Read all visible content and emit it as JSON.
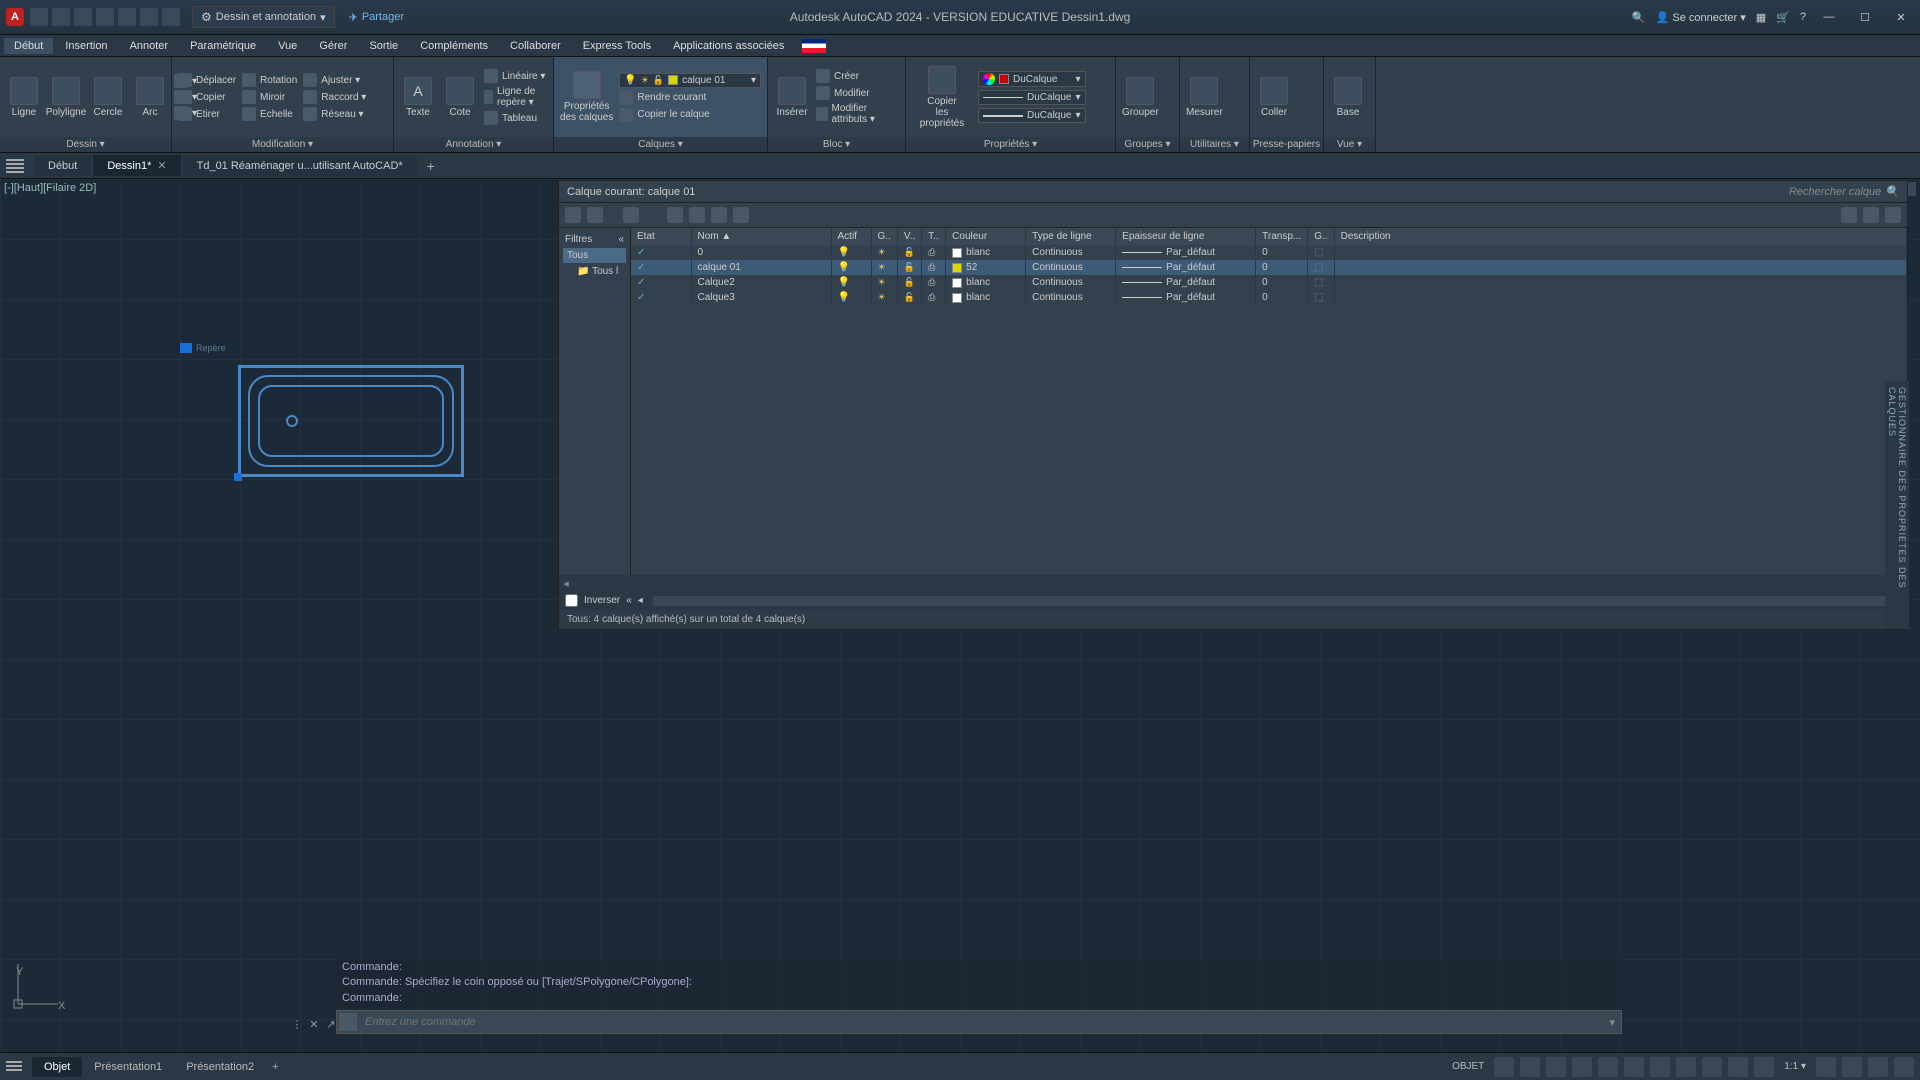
{
  "titlebar": {
    "logo": "A",
    "workspace": "Dessin et annotation",
    "share": "Partager",
    "center": "Autodesk AutoCAD 2024 - VERSION EDUCATIVE   Dessin1.dwg",
    "signin": "Se connecter"
  },
  "menus": [
    "Début",
    "Insertion",
    "Annoter",
    "Paramétrique",
    "Vue",
    "Gérer",
    "Sortie",
    "Compléments",
    "Collaborer",
    "Express Tools",
    "Applications associées"
  ],
  "menu_active": 0,
  "ribbon": {
    "dessin": {
      "title": "Dessin ▾",
      "items": [
        "Ligne",
        "Polyligne",
        "Cercle",
        "Arc"
      ]
    },
    "modif": {
      "title": "Modification ▾",
      "rows": [
        {
          "icon": "move",
          "label": "Déplacer"
        },
        {
          "icon": "rotate",
          "label": "Rotation"
        },
        {
          "icon": "trim",
          "label": "Ajuster ▾"
        },
        {
          "icon": "copy",
          "label": "Copier"
        },
        {
          "icon": "mirror",
          "label": "Miroir"
        },
        {
          "icon": "fillet",
          "label": "Raccord ▾"
        },
        {
          "icon": "stretch",
          "label": "Etirer"
        },
        {
          "icon": "scale",
          "label": "Echelle"
        },
        {
          "icon": "array",
          "label": "Réseau ▾"
        }
      ]
    },
    "annot": {
      "title": "Annotation ▾",
      "big": [
        "Texte",
        "Cote"
      ],
      "rows": [
        "Linéaire ▾",
        "Ligne de repère ▾",
        "Tableau"
      ]
    },
    "calques": {
      "title": "Calques ▾",
      "big_top": "Propriétés",
      "big_bot": "des calques",
      "current_layer": "calque 01",
      "rows": [
        "Rendre courant",
        "Copier le calque"
      ]
    },
    "bloc": {
      "title": "Bloc ▾",
      "big": "Insérer",
      "rows": [
        "Créer",
        "Modifier",
        "Modifier attributs ▾"
      ]
    },
    "props": {
      "title": "Propriétés ▾",
      "big_top": "Copier",
      "big_bot": "les propriétés",
      "bycolor": "DuCalque",
      "byline": "DuCalque",
      "bylw": "DuCalque"
    },
    "groupes": {
      "title": "Groupes ▾",
      "big": "Grouper"
    },
    "utils": {
      "title": "Utilitaires ▾",
      "big": "Mesurer"
    },
    "clip": {
      "title": "Presse-papiers",
      "big": "Coller"
    },
    "vue": {
      "title": "Vue ▾",
      "big": "Base"
    }
  },
  "doctabs": {
    "start": "Début",
    "tabs": [
      "Dessin1*",
      "Td_01 Réaménager u...utilisant AutoCAD*"
    ],
    "active": 0
  },
  "viewport_label": "[-][Haut][Filaire 2D]",
  "marker_label": "Repère",
  "palette": {
    "title_prefix": "Calque courant: ",
    "current": "calque 01",
    "search_placeholder": "Rechercher calque",
    "filters_header": "Filtres",
    "filters": [
      "Tous",
      "Tous l"
    ],
    "filter_sel": 0,
    "columns": [
      "Etat",
      "Nom",
      "▲",
      "Actif",
      "G..",
      "V..",
      "T..",
      "Couleur",
      "Type de ligne",
      "Epaisseur de ligne",
      "Transp...",
      "G..",
      "Description"
    ],
    "rows": [
      {
        "name": "0",
        "color": "blanc",
        "colhex": "#ffffff",
        "ltype": "Continuous",
        "lw": "Par_défaut",
        "tr": "0"
      },
      {
        "name": "calque 01",
        "color": "52",
        "colhex": "#d8d800",
        "ltype": "Continuous",
        "lw": "Par_défaut",
        "tr": "0",
        "sel": true
      },
      {
        "name": "Calque2",
        "color": "blanc",
        "colhex": "#ffffff",
        "ltype": "Continuous",
        "lw": "Par_défaut",
        "tr": "0"
      },
      {
        "name": "Calque3",
        "color": "blanc",
        "colhex": "#ffffff",
        "ltype": "Continuous",
        "lw": "Par_défaut",
        "tr": "0"
      }
    ],
    "invert_label": "Inverser",
    "footer": "Tous: 4 calque(s) affiché(s) sur un total de 4 calque(s)",
    "side_label": "GESTIONNAIRE DES PROPRIETES DES CALQUES"
  },
  "cmd": {
    "hist": [
      "Commande:",
      "Commande: Spécifiez le coin opposé ou [Trajet/SPolygone/CPolygone]:",
      "Commande:"
    ],
    "placeholder": "Entrez une commande"
  },
  "bottombar": {
    "tabs": [
      "Objet",
      "Présentation1",
      "Présentation2"
    ],
    "active": 0,
    "objet": "OBJET",
    "scale": "1:1 ▾"
  },
  "ucs": {
    "x": "X",
    "y": "Y"
  }
}
